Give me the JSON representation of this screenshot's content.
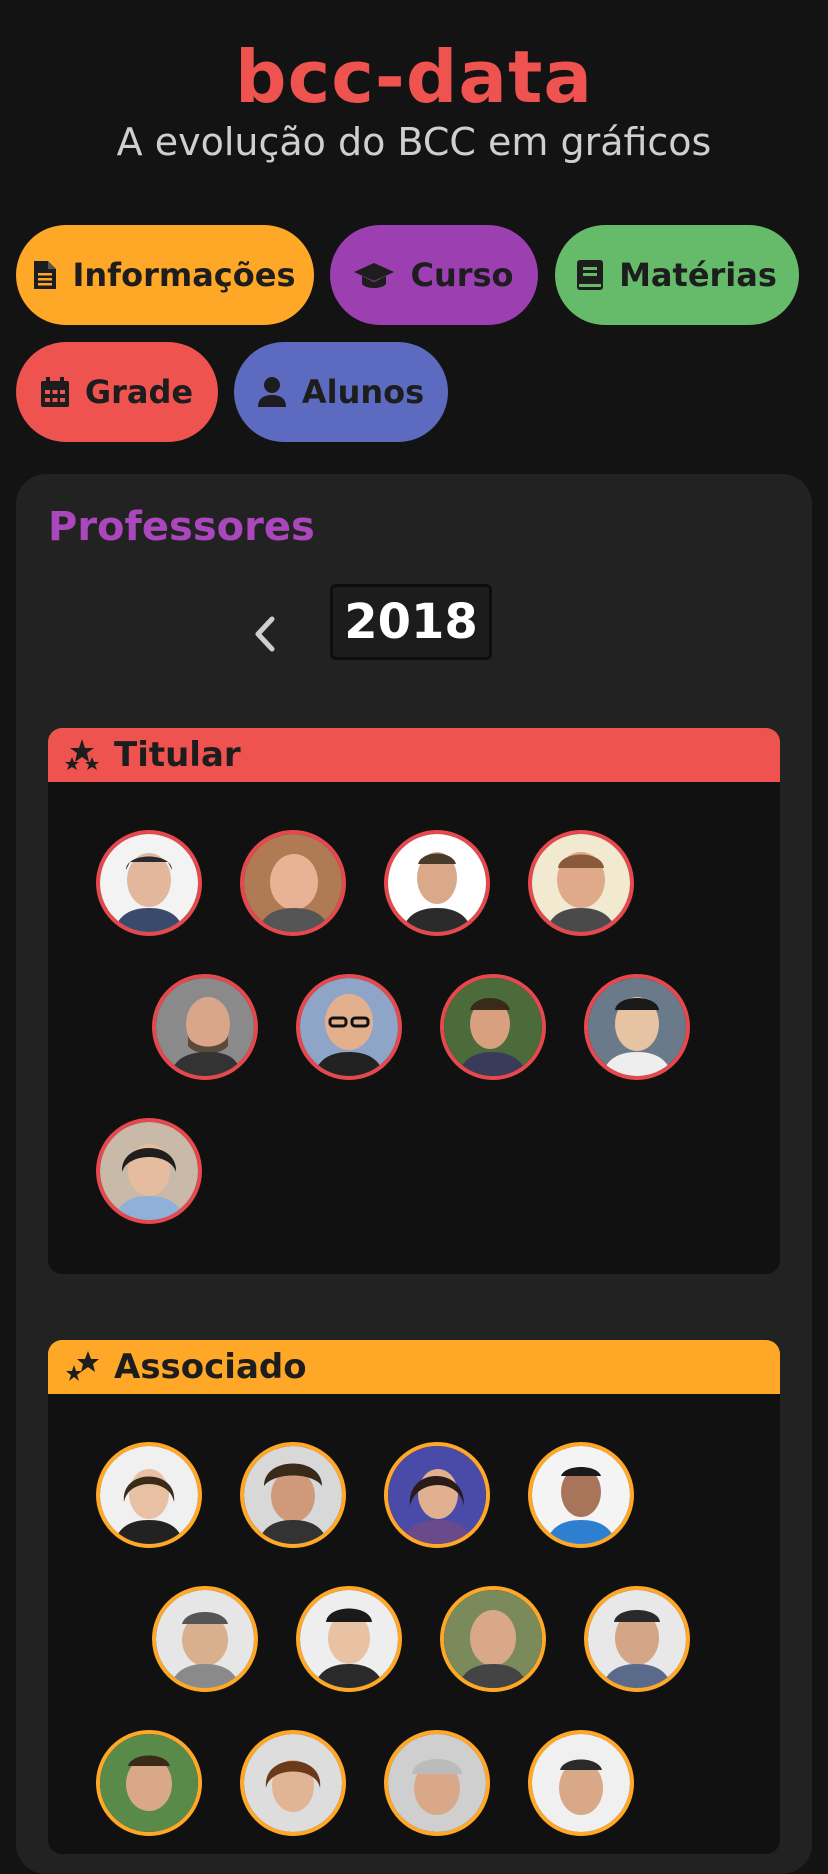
{
  "header": {
    "title": "bcc-data",
    "subtitle": "A evolução do BCC em gráficos"
  },
  "nav": [
    {
      "label": "Informações",
      "icon": "file-icon",
      "color": "#ffa726"
    },
    {
      "label": "Curso",
      "icon": "graduation-cap-icon",
      "color": "#9c3fb0"
    },
    {
      "label": "Matérias",
      "icon": "book-icon",
      "color": "#66bb6a"
    },
    {
      "label": "Grade",
      "icon": "calendar-icon",
      "color": "#ef5350"
    },
    {
      "label": "Alunos",
      "icon": "user-icon",
      "color": "#5c6bc0"
    }
  ],
  "professores": {
    "title": "Professores",
    "year": "2018",
    "groups": [
      {
        "name": "Titular",
        "icon": "stars-icon",
        "color": "#ef5350",
        "count": 9
      },
      {
        "name": "Associado",
        "icon": "stars-icon",
        "color": "#ffa726",
        "count": 12
      }
    ]
  }
}
